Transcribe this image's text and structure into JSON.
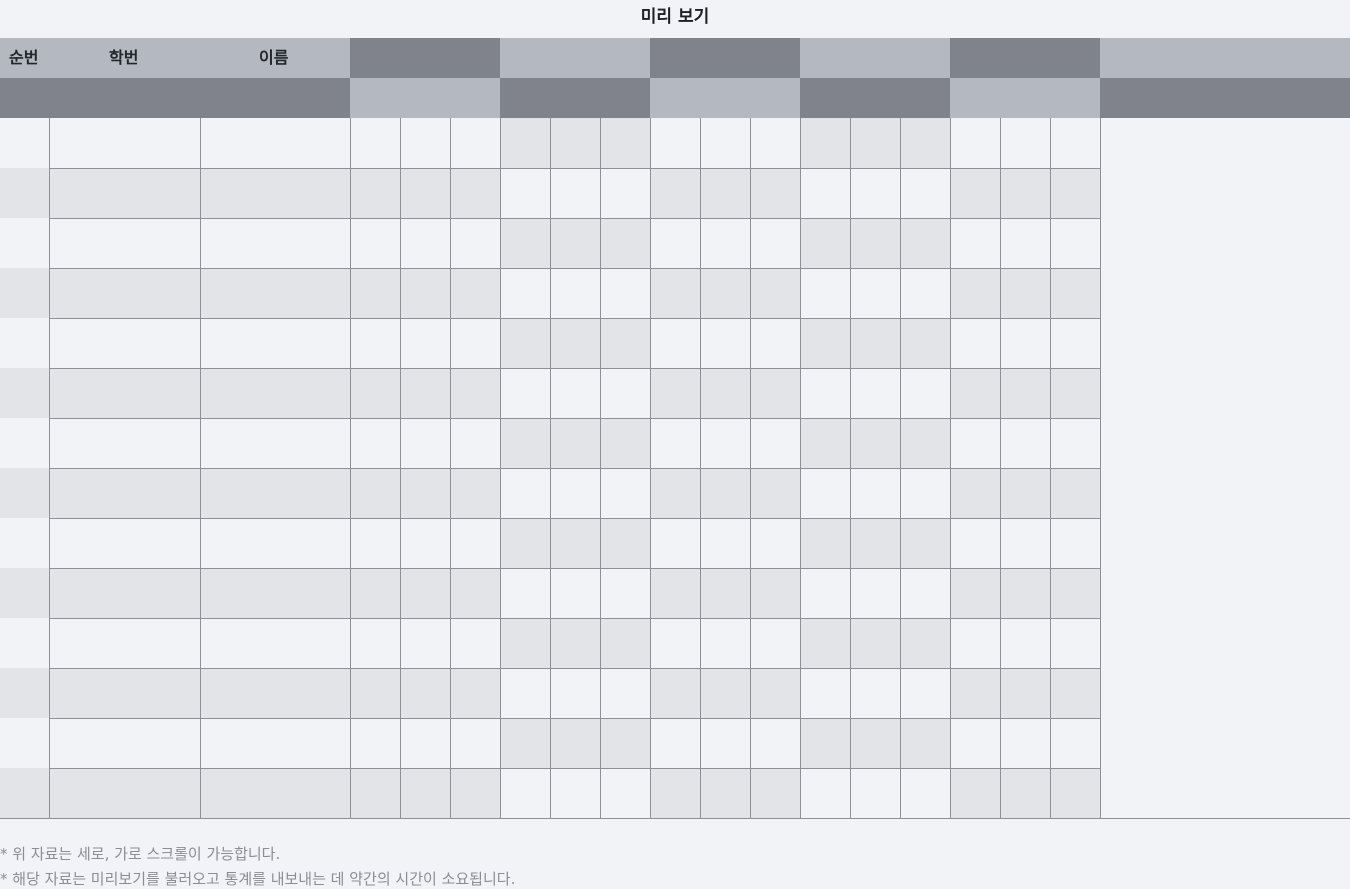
{
  "page_title": "미리 보기",
  "table": {
    "columns": {
      "seq": "순번",
      "student_id": "학번",
      "name": "이름"
    },
    "row_count": 14,
    "group_count": 5,
    "sub_columns_per_group": 3
  },
  "colors": {
    "header_dark": "#81838c",
    "header_light": "#b4b8c1",
    "cell_white": "#f2f3f7",
    "cell_gray": "#e2e4e8",
    "grid_line": "#8e9096",
    "note_text": "#8b8d93"
  },
  "notes": [
    "* 위 자료는 세로, 가로 스크롤이 가능합니다.",
    "* 해당 자료는 미리보기를 불러오고 통계를 내보내는 데 약간의 시간이 소요됩니다."
  ]
}
